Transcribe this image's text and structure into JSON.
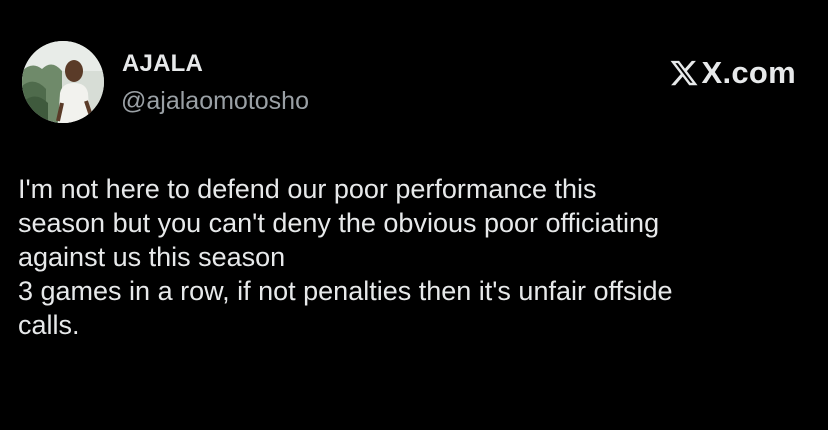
{
  "author": {
    "display_name": "AJALA",
    "handle": "@ajalaomotosho",
    "avatar_icon": "profile-photo"
  },
  "brand": {
    "logo_icon": "x-logo-icon",
    "domain": "X.com"
  },
  "tweet": {
    "lines": [
      "I'm not here to defend our poor performance this",
      "season but you can't deny the obvious poor officiating",
      "against us this season",
      "3 games in a row, if not penalties then it's unfair offside",
      "calls."
    ]
  },
  "colors": {
    "background": "#000000",
    "text_primary": "#e7e9ea",
    "text_secondary": "#9aa0a5"
  }
}
